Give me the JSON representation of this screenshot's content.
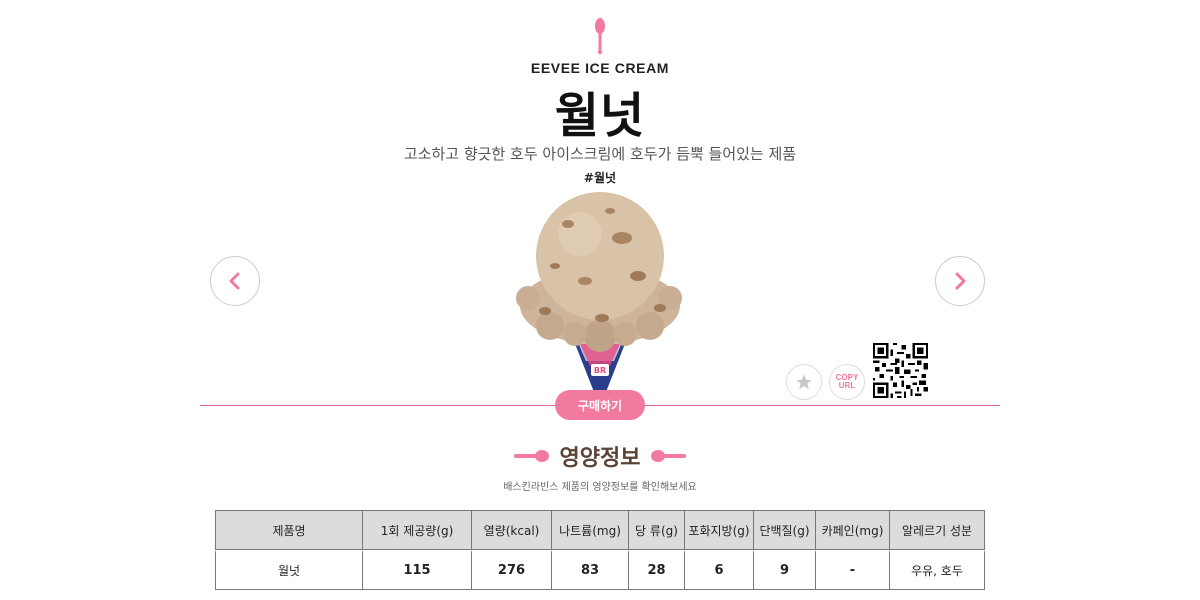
{
  "brand": {
    "name": "EEVEE ICE CREAM",
    "accent": "#f27a9e"
  },
  "product": {
    "name": "월넛",
    "description": "고소하고 향긋한 호두 아이스크림에 호두가 듬뿍 들어있는 제품",
    "hashtag": "#월넛"
  },
  "actions": {
    "buy_label": "구매하기",
    "copy_url_line1": "COPY",
    "copy_url_line2": "URL"
  },
  "nutrition": {
    "title": "영양정보",
    "description": "배스킨라빈스 제품의 영양정보를 확인해보세요",
    "headers": [
      "제품명",
      "1회 제공량(g)",
      "열량(kcal)",
      "나트륨(mg)",
      "당 류(g)",
      "포화지방(g)",
      "단백질(g)",
      "카페인(mg)",
      "알레르기 성분"
    ],
    "rows": [
      [
        "월넛",
        "115",
        "276",
        "83",
        "28",
        "6",
        "9",
        "-",
        "우유, 호두"
      ]
    ]
  }
}
